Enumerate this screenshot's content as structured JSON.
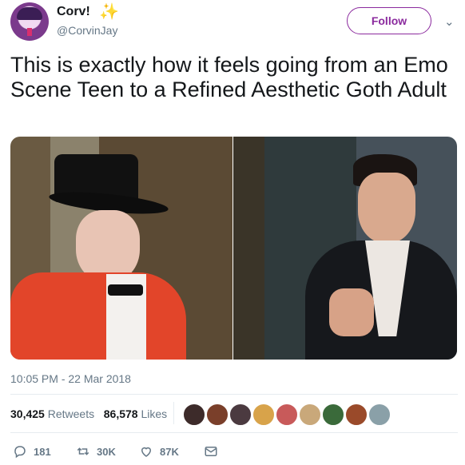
{
  "author": {
    "name": "Corv!",
    "sparkle": "✨",
    "handle": "@CorvinJay"
  },
  "follow_label": "Follow",
  "tweet_text": "This is exactly how it feels going from an Emo Scene Teen to a Refined Aesthetic Goth Adult",
  "timestamp": "10:05 PM - 22 Mar 2018",
  "stats": {
    "retweets_count": "30,425",
    "retweets_label": "Retweets",
    "likes_count": "86,578",
    "likes_label": "Likes"
  },
  "likers": [
    "#3d2b2a",
    "#7a3f2a",
    "#4b3a40",
    "#d8a34a",
    "#c85a5a",
    "#c9a87a",
    "#3a6a3a",
    "#9a4a2a",
    "#8aa0a8"
  ],
  "actions": {
    "replies": "181",
    "retweets": "30K",
    "likes": "87K"
  },
  "colors": {
    "accent": "#8b2a9e",
    "secondary_text": "#657786"
  }
}
